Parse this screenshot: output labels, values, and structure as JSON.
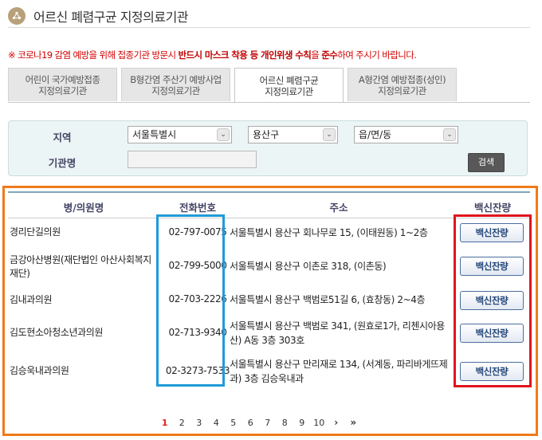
{
  "page": {
    "title": "어르신 폐렴구균 지정의료기관",
    "notice": {
      "prefix": "※ 코로나19 감염 예방을 위해 접종기관 방문시 ",
      "bold1": "반드시 마스크 착용 등 개인위생 수칙",
      "middle": "을 ",
      "bold2": "준수",
      "suffix": "하여 주시기 바랍니다."
    }
  },
  "tabs": [
    {
      "line1": "어린이 국가예방접종",
      "line2": "지정의료기관",
      "active": false
    },
    {
      "line1": "B형간염 주산기 예방사업",
      "line2": "지정의료기관",
      "active": false
    },
    {
      "line1": "어르신 폐렴구균",
      "line2": "지정의료기관",
      "active": true
    },
    {
      "line1": "A형간염 예방접종(성인)",
      "line2": "지정의료기관",
      "active": false
    }
  ],
  "search": {
    "region_label": "지역",
    "institution_label": "기관명",
    "city_value": "서울특별시",
    "district_value": "용산구",
    "town_value": "읍/면/동",
    "institution_value": "",
    "search_button": "검색"
  },
  "results": {
    "headers": {
      "name": "병/의원명",
      "phone": "전화번호",
      "address": "주소",
      "vaccine": "백신잔량"
    },
    "rows": [
      {
        "name": "경리단길의원",
        "phone": "02-797-0075",
        "address": "서울특별시 용산구 회나무로 15, (이태원동) 1~2층",
        "button": "백신잔량"
      },
      {
        "name": "금강아산병원(재단법인 아산사회복지재단)",
        "phone": "02-799-5000",
        "address": "서울특별시 용산구 이촌로 318, (이촌동)",
        "button": "백신잔량"
      },
      {
        "name": "김내과의원",
        "phone": "02-703-2226",
        "address": "서울특별시 용산구 백범로51길 6, (효창동) 2~4층",
        "button": "백신잔량"
      },
      {
        "name": "김도현소아청소년과의원",
        "phone": "02-713-9340",
        "address": "서울특별시 용산구 백범로 341, (원효로1가, 리첸시아용산) A동 3층 303호",
        "button": "백신잔량"
      },
      {
        "name": "김승욱내과의원",
        "phone": "02-3273-7533",
        "address": "서울특별시 용산구 만리재로 134, (서계동, 파리바게뜨제과) 3층 김승욱내과",
        "button": "백신잔량"
      }
    ]
  },
  "pagination": {
    "pages": [
      "1",
      "2",
      "3",
      "4",
      "5",
      "6",
      "7",
      "8",
      "9",
      "10"
    ],
    "current": "1",
    "next": "›",
    "last": "»"
  },
  "colors": {
    "orange_highlight": "#f07a1a",
    "blue_highlight": "#1f9bd8",
    "red_highlight": "#e0141c",
    "notice_red": "#d40000",
    "current_page": "#e52020"
  }
}
